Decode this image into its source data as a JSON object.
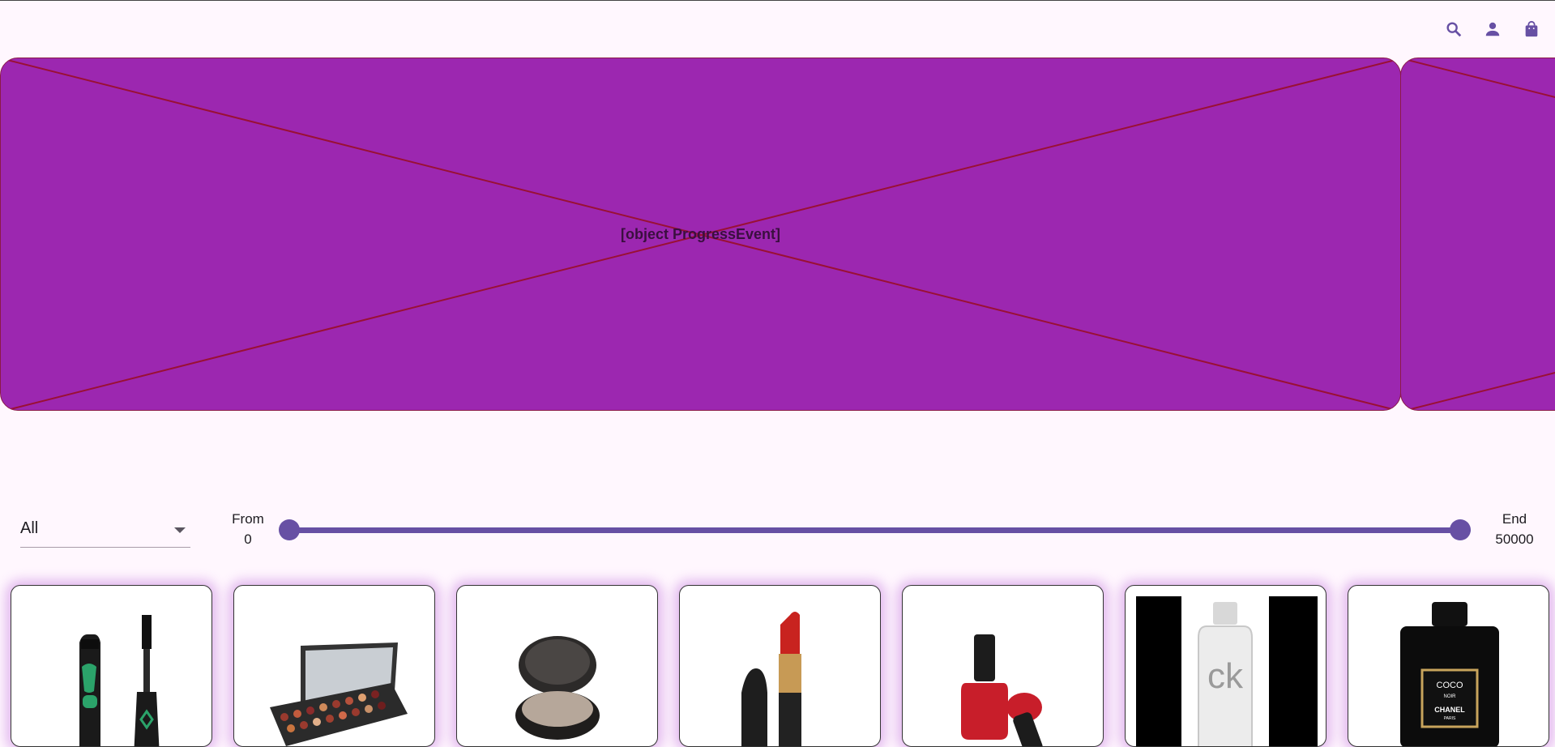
{
  "header": {
    "icons": [
      "search-icon",
      "person-icon",
      "shopping-bag-icon"
    ]
  },
  "carousel": {
    "slides": [
      {
        "error_text": "[object ProgressEvent]"
      },
      {
        "error_text": ""
      }
    ]
  },
  "filters": {
    "category": {
      "selected": "All"
    },
    "price_range": {
      "from_label": "From",
      "from_value": "0",
      "end_label": "End",
      "end_value": "50000"
    }
  },
  "products": [
    {
      "image": "mascara"
    },
    {
      "image": "eyeshadow-palette"
    },
    {
      "image": "compact-powder"
    },
    {
      "image": "lipstick"
    },
    {
      "image": "nail-polish"
    },
    {
      "image": "ck-one-perfume",
      "label": "ck"
    },
    {
      "image": "chanel-perfume",
      "label_line1": "COCO",
      "label_line2": "NOIR",
      "label_line3": "CHANEL",
      "label_line4": "PARIS"
    }
  ],
  "colors": {
    "accent": "#6750a4",
    "banner": "#9c27b0",
    "background": "#fff7fe"
  }
}
